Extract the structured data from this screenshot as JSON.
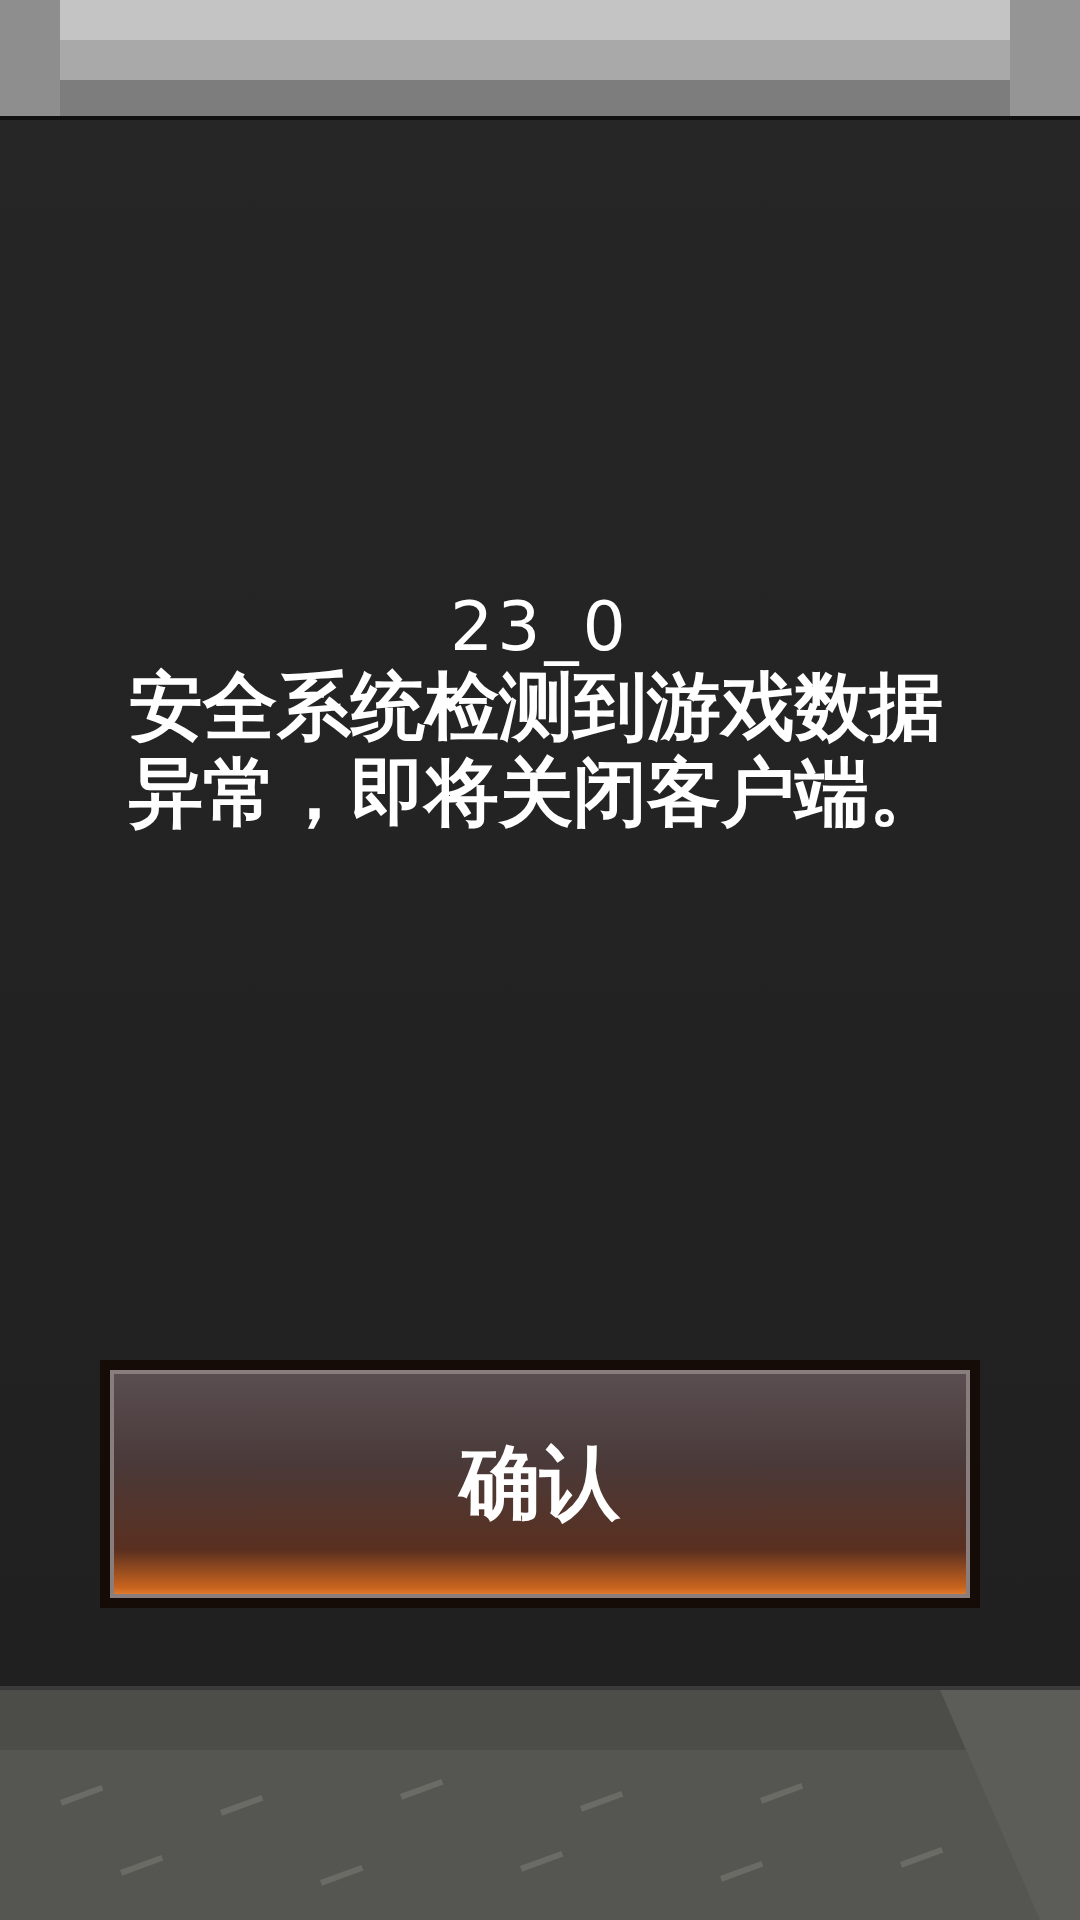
{
  "dialog": {
    "code": "23_0",
    "message": "安全系统检测到游戏数据异常，即将关闭客户端。"
  },
  "buttons": [
    {
      "label": "确认"
    }
  ]
}
